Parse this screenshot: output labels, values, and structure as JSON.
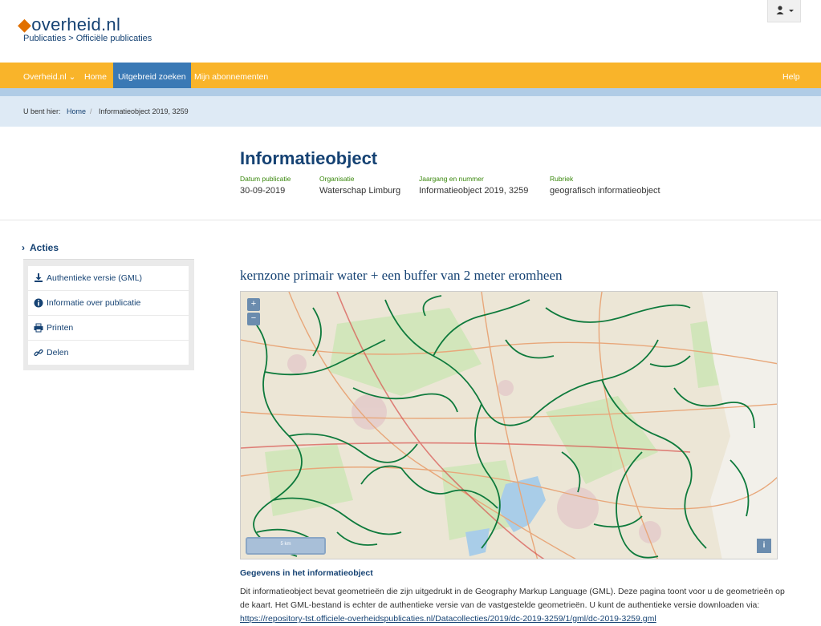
{
  "header": {
    "logo_text": "overheid.nl",
    "tagline": "Publicaties > Officiële publicaties"
  },
  "nav": {
    "items": [
      {
        "label": "Overheid.nl ⌄"
      },
      {
        "label": "Home"
      },
      {
        "label": "Uitgebreid zoeken"
      },
      {
        "label": "Mijn abonnementen"
      }
    ],
    "help": "Help"
  },
  "breadcrumb": {
    "prefix": "U bent hier:",
    "home": "Home",
    "sep": "/",
    "current": "Informatieobject 2019, 3259"
  },
  "document": {
    "title": "Informatieobject",
    "meta": [
      {
        "label": "Datum publicatie",
        "value": "30-09-2019"
      },
      {
        "label": "Organisatie",
        "value": "Waterschap Limburg"
      },
      {
        "label": "Jaargang en nummer",
        "value": "Informatieobject 2019, 3259"
      },
      {
        "label": "Rubriek",
        "value": "geografisch informatieobject"
      }
    ]
  },
  "actions": {
    "heading": "Acties",
    "items": [
      {
        "label": "Authentieke versie (GML)",
        "icon": "download-icon"
      },
      {
        "label": "Informatie over publicatie",
        "icon": "info-icon"
      },
      {
        "label": "Printen",
        "icon": "print-icon"
      },
      {
        "label": "Delen",
        "icon": "link-icon"
      }
    ]
  },
  "map": {
    "title": "kernzone primair water + een buffer van 2 meter eromheen",
    "zoom_in": "+",
    "zoom_out": "−",
    "scale": "5 km",
    "info": "i"
  },
  "details": {
    "heading": "Gegevens in het informatieobject",
    "text": "Dit informatieobject bevat geometrieën die zijn uitgedrukt in de Geography Markup Language (GML). Deze pagina toont voor u de geometrieën op de kaart. Het GML-bestand is echter de authentieke versie van de vastgestelde geometrieën. U kunt de authentieke versie downloaden via:",
    "link": "https://repository-tst.officiele-overheidspublicaties.nl/Datacollecties/2019/dc-2019-3259/1/gml/dc-2019-3259.gml"
  },
  "colors": {
    "brand_blue": "#154273",
    "nav_orange": "#f9b42a",
    "water_green": "#0e7a3c"
  }
}
